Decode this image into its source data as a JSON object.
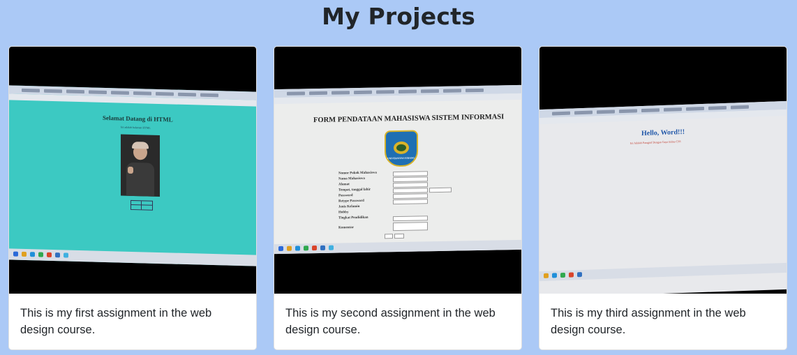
{
  "page": {
    "title": "My Projects"
  },
  "projects": [
    {
      "image_alt": "Photo of a monitor showing a cyan HTML page",
      "screen_heading": "Selamat Datang di HTML",
      "screen_sub": "Ini adalah halaman HTML",
      "description": "This is my first assignment in the web design course."
    },
    {
      "image_alt": "Photo of a monitor showing a student registration form",
      "screen_heading": "FORM PENDATAAN MAHASISWA SISTEM INFORMASI",
      "screen_sub": "UNIVERSITAS SUBANG",
      "form_labels": [
        "Nomor Pokok Mahasiswa",
        "Nama Mahasiswa",
        "Alamat",
        "Tempat, tanggal lahir",
        "Password",
        "Retype Password",
        "Jenis Kelamin",
        "Hobby",
        "Tingkat Pendidikan",
        "Komentar"
      ],
      "description": "This is my second assignment in the web design course."
    },
    {
      "image_alt": "Photo of a monitor showing a Hello World page",
      "screen_heading": "Hello, Word!!!",
      "screen_sub": "Ini Adalah Paragraf Dengan Gaya Inline CSS",
      "description": "This is my third assignment in the web design course."
    }
  ],
  "colors": {
    "background": "#abc9f6",
    "card": "#ffffff",
    "text": "#212529",
    "screen1": "#3cc9c2",
    "screen2": "#ecedec",
    "screen3": "#e8e9ec"
  }
}
